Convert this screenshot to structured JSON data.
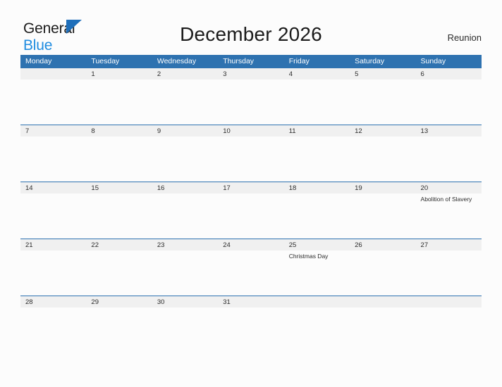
{
  "brand": {
    "name_line1": "General",
    "name_line2": "Blue",
    "mark": "triangle-flag-icon",
    "colors": {
      "dark_text": "#1b1b1b",
      "blue_text": "#1f8ce0",
      "mark_blue": "#1f6fba"
    }
  },
  "header": {
    "title": "December 2026",
    "region": "Reunion"
  },
  "calendar": {
    "colors": {
      "header_bg": "#2e72b0",
      "header_text": "#ffffff",
      "date_row_bg": "#f0f0f0",
      "separator": "#2e72b0",
      "page_bg": "#fcfcfc"
    },
    "weekdays": [
      "Monday",
      "Tuesday",
      "Wednesday",
      "Thursday",
      "Friday",
      "Saturday",
      "Sunday"
    ],
    "weeks": [
      {
        "days": [
          {
            "date": "",
            "event": ""
          },
          {
            "date": "1",
            "event": ""
          },
          {
            "date": "2",
            "event": ""
          },
          {
            "date": "3",
            "event": ""
          },
          {
            "date": "4",
            "event": ""
          },
          {
            "date": "5",
            "event": ""
          },
          {
            "date": "6",
            "event": ""
          }
        ]
      },
      {
        "days": [
          {
            "date": "7",
            "event": ""
          },
          {
            "date": "8",
            "event": ""
          },
          {
            "date": "9",
            "event": ""
          },
          {
            "date": "10",
            "event": ""
          },
          {
            "date": "11",
            "event": ""
          },
          {
            "date": "12",
            "event": ""
          },
          {
            "date": "13",
            "event": ""
          }
        ]
      },
      {
        "days": [
          {
            "date": "14",
            "event": ""
          },
          {
            "date": "15",
            "event": ""
          },
          {
            "date": "16",
            "event": ""
          },
          {
            "date": "17",
            "event": ""
          },
          {
            "date": "18",
            "event": ""
          },
          {
            "date": "19",
            "event": ""
          },
          {
            "date": "20",
            "event": "Abolition of Slavery"
          }
        ]
      },
      {
        "days": [
          {
            "date": "21",
            "event": ""
          },
          {
            "date": "22",
            "event": ""
          },
          {
            "date": "23",
            "event": ""
          },
          {
            "date": "24",
            "event": ""
          },
          {
            "date": "25",
            "event": "Christmas Day"
          },
          {
            "date": "26",
            "event": ""
          },
          {
            "date": "27",
            "event": ""
          }
        ]
      },
      {
        "days": [
          {
            "date": "28",
            "event": ""
          },
          {
            "date": "29",
            "event": ""
          },
          {
            "date": "30",
            "event": ""
          },
          {
            "date": "31",
            "event": ""
          },
          {
            "date": "",
            "event": ""
          },
          {
            "date": "",
            "event": ""
          },
          {
            "date": "",
            "event": ""
          }
        ]
      }
    ]
  }
}
